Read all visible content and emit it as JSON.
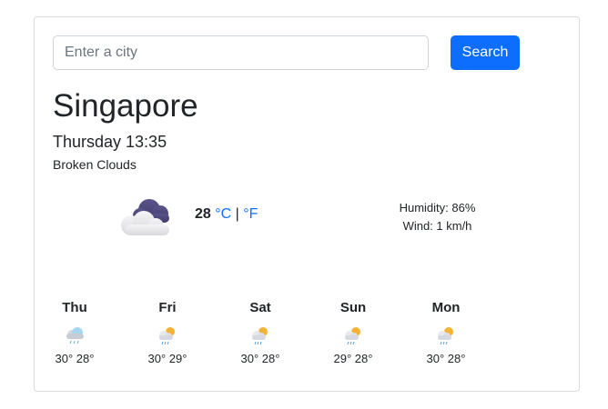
{
  "search": {
    "placeholder": "Enter a city",
    "button_label": "Search"
  },
  "current": {
    "city": "Singapore",
    "datetime": "Thursday 13:35",
    "description": "Broken Clouds",
    "icon": "broken-clouds-icon",
    "temperature": "28",
    "unit_celsius": "°C",
    "unit_separator": "|",
    "unit_fahrenheit": "°F",
    "humidity": "Humidity: 86%",
    "wind": "Wind: 1 km/h"
  },
  "forecast": [
    {
      "day": "Thu",
      "temps": "30° 28°",
      "icon": "cloud-rain-icon"
    },
    {
      "day": "Fri",
      "temps": "30° 29°",
      "icon": "sun-cloud-rain-icon"
    },
    {
      "day": "Sat",
      "temps": "30° 28°",
      "icon": "sun-cloud-rain-icon"
    },
    {
      "day": "Sun",
      "temps": "29° 28°",
      "icon": "sun-cloud-rain-icon"
    },
    {
      "day": "Mon",
      "temps": "30° 28°",
      "icon": "sun-cloud-rain-icon"
    }
  ],
  "colors": {
    "accent": "#0d6efd",
    "text": "#212529",
    "border": "#dcdcdc"
  }
}
